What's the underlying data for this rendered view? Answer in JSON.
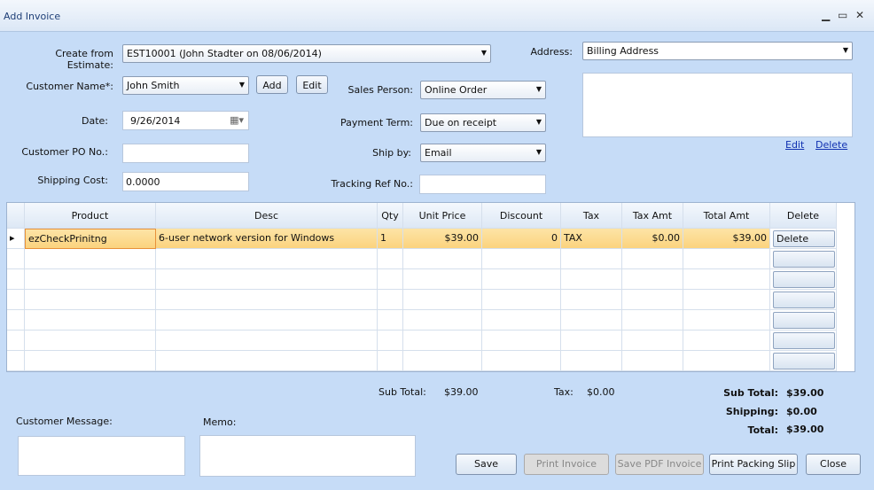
{
  "window": {
    "title": "Add Invoice",
    "minimize": "▁",
    "maximize": "▭",
    "close": "✕"
  },
  "form": {
    "estimate_label": "Create from Estimate:",
    "estimate_value": "EST10001 (John Stadter on 08/06/2014)",
    "customer_label": "Customer Name*:",
    "customer_value": "John Smith",
    "add_label": "Add",
    "edit_label": "Edit",
    "date_label": "Date:",
    "date_value": "9/26/2014",
    "po_label": "Customer PO No.:",
    "po_value": "",
    "shipping_cost_label": "Shipping Cost:",
    "shipping_cost_value": "0.0000",
    "sales_person_label": "Sales Person:",
    "sales_person_value": "Online Order",
    "payment_term_label": "Payment Term:",
    "payment_term_value": "Due on receipt",
    "ship_by_label": "Ship by:",
    "ship_by_value": "Email",
    "tracking_label": "Tracking Ref No.:",
    "tracking_value": "",
    "address_label": "Address:",
    "address_value": "Billing Address",
    "address_text": "",
    "address_edit": "Edit",
    "address_delete": "Delete"
  },
  "grid": {
    "columns": [
      "Product",
      "Desc",
      "Qty",
      "Unit Price",
      "Discount",
      "Tax",
      "Tax Amt",
      "Total Amt",
      "Delete"
    ],
    "rows": [
      {
        "product": "ezCheckPrinitng",
        "desc": "6-user network version for Windows",
        "qty": "1",
        "unit_price": "$39.00",
        "discount": "0",
        "tax": "TAX",
        "tax_amt": "$0.00",
        "total_amt": "$39.00",
        "delete": "Delete"
      }
    ]
  },
  "summary": {
    "sub_total_label": "Sub Total:",
    "sub_total": "$39.00",
    "tax_label": "Tax:",
    "tax": "$0.00",
    "r_sub_total_label": "Sub Total:",
    "r_sub_total": "$39.00",
    "shipping_label": "Shipping:",
    "shipping": "$0.00",
    "total_label": "Total:",
    "total": "$39.00"
  },
  "notes": {
    "customer_message_label": "Customer Message:",
    "memo_label": "Memo:"
  },
  "buttons": {
    "save": "Save",
    "print_invoice": "Print Invoice",
    "save_pdf": "Save PDF Invoice",
    "print_packing": "Print Packing Slip",
    "close": "Close"
  }
}
